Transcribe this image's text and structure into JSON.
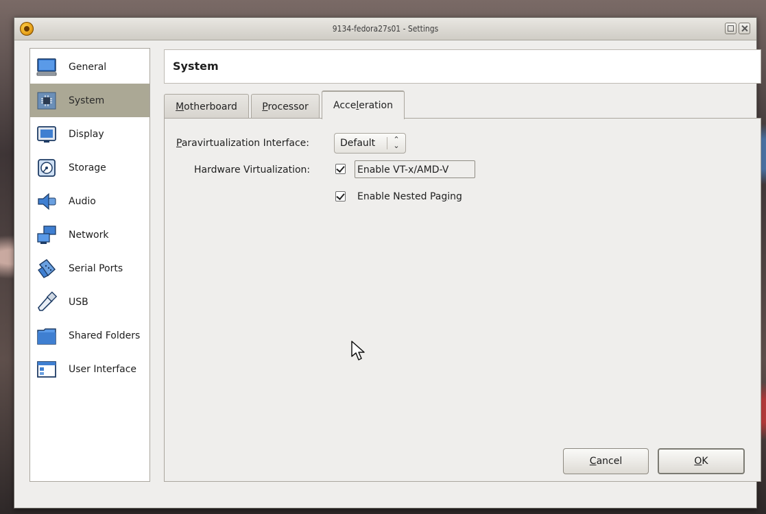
{
  "window": {
    "title": "9134-fedora27s01 - Settings"
  },
  "sidebar": {
    "items": [
      {
        "label": "General",
        "icon": "monitor-icon"
      },
      {
        "label": "System",
        "icon": "chip-icon",
        "selected": true
      },
      {
        "label": "Display",
        "icon": "display-icon"
      },
      {
        "label": "Storage",
        "icon": "disk-icon"
      },
      {
        "label": "Audio",
        "icon": "speaker-icon"
      },
      {
        "label": "Network",
        "icon": "network-icon"
      },
      {
        "label": "Serial Ports",
        "icon": "serial-port-icon"
      },
      {
        "label": "USB",
        "icon": "usb-icon"
      },
      {
        "label": "Shared Folders",
        "icon": "folder-icon"
      },
      {
        "label": "User Interface",
        "icon": "window-icon"
      }
    ]
  },
  "header": {
    "title": "System"
  },
  "tabs": [
    {
      "label": "Motherboard",
      "mnemonic": "M",
      "rest": "otherboard"
    },
    {
      "label": "Processor",
      "mnemonic": "P",
      "rest": "rocessor"
    },
    {
      "label": "Acceleration",
      "pre": "Acce",
      "mnemonic": "l",
      "rest": "eration",
      "active": true
    }
  ],
  "acceleration": {
    "paravirt": {
      "pre": "",
      "mnemonic": "P",
      "rest": "aravirtualization Interface:",
      "value": "Default"
    },
    "hw_virt_label": "Hardware Virtualization:",
    "enable_vtx": {
      "label": "Enable VT-x/AMD-V",
      "checked": true
    },
    "enable_nested": {
      "pre": "Enable Nested Pa",
      "mnemonic": "g",
      "rest": "ing",
      "checked": true
    }
  },
  "buttons": {
    "cancel": {
      "mnemonic": "C",
      "rest": "ancel"
    },
    "ok": {
      "mnemonic": "O",
      "rest": "K"
    }
  },
  "colors": {
    "selected_bg": "#aba895",
    "window_bg": "#efeeec"
  }
}
